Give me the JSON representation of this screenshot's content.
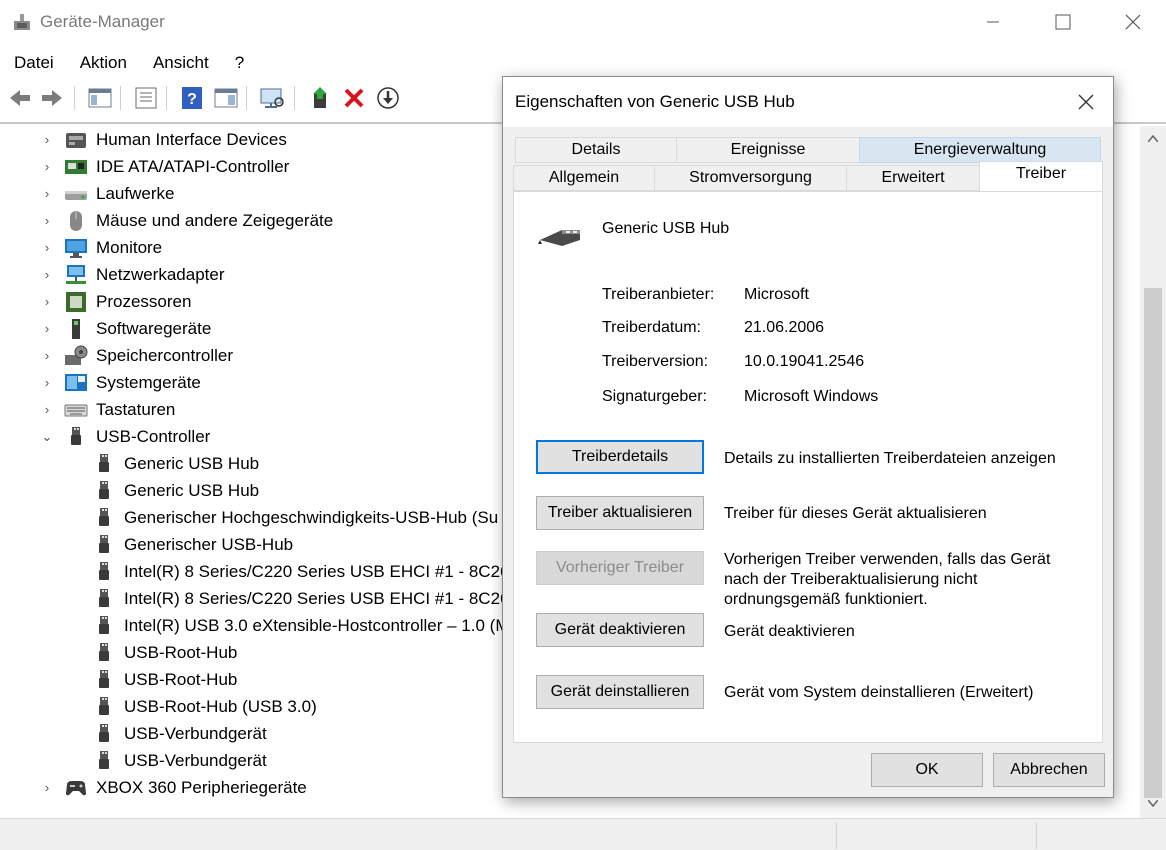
{
  "window": {
    "title": "Geräte-Manager"
  },
  "menu": [
    "Datei",
    "Aktion",
    "Ansicht",
    "?"
  ],
  "tree": {
    "rows": [
      {
        "label": "Human Interface Devices",
        "icon": "hid-icon",
        "expander": "›"
      },
      {
        "label": "IDE ATA/ATAPI-Controller",
        "icon": "ide-controller-icon",
        "expander": "›"
      },
      {
        "label": "Laufwerke",
        "icon": "drive-icon",
        "expander": "›"
      },
      {
        "label": "Mäuse und andere Zeigegeräte",
        "icon": "mouse-icon",
        "expander": "›"
      },
      {
        "label": "Monitore",
        "icon": "monitor-icon",
        "expander": "›"
      },
      {
        "label": "Netzwerkadapter",
        "icon": "network-adapter-icon",
        "expander": "›"
      },
      {
        "label": "Prozessoren",
        "icon": "processor-icon",
        "expander": "›"
      },
      {
        "label": "Softwaregeräte",
        "icon": "software-device-icon",
        "expander": "›"
      },
      {
        "label": "Speichercontroller",
        "icon": "storage-controller-icon",
        "expander": "›"
      },
      {
        "label": "Systemgeräte",
        "icon": "system-device-icon",
        "expander": "›"
      },
      {
        "label": "Tastaturen",
        "icon": "keyboard-icon",
        "expander": "›"
      },
      {
        "label": "USB-Controller",
        "icon": "usb-icon",
        "expander": "⌄"
      },
      {
        "label": "Generic USB Hub",
        "icon": "usb-icon",
        "child": true
      },
      {
        "label": "Generic USB Hub",
        "icon": "usb-icon",
        "child": true
      },
      {
        "label": "Generischer Hochgeschwindigkeits-USB-Hub (Su",
        "icon": "usb-icon",
        "child": true
      },
      {
        "label": "Generischer USB-Hub",
        "icon": "usb-icon",
        "child": true
      },
      {
        "label": "Intel(R) 8 Series/C220 Series USB EHCI #1 - 8C26",
        "icon": "usb-icon",
        "child": true
      },
      {
        "label": "Intel(R) 8 Series/C220 Series USB EHCI #1 - 8C26",
        "icon": "usb-icon",
        "child": true
      },
      {
        "label": "Intel(R) USB 3.0 eXtensible-Hostcontroller – 1.0 (M",
        "icon": "usb-icon",
        "child": true
      },
      {
        "label": "USB-Root-Hub",
        "icon": "usb-icon",
        "child": true
      },
      {
        "label": "USB-Root-Hub",
        "icon": "usb-icon",
        "child": true
      },
      {
        "label": "USB-Root-Hub (USB 3.0)",
        "icon": "usb-icon",
        "child": true
      },
      {
        "label": "USB-Verbundgerät",
        "icon": "usb-icon",
        "child": true
      },
      {
        "label": "USB-Verbundgerät",
        "icon": "usb-icon",
        "child": true
      },
      {
        "label": "XBOX 360 Peripheriegeräte",
        "icon": "gamepad-icon",
        "expander": "›"
      }
    ]
  },
  "dialog": {
    "title": "Eigenschaften von Generic USB Hub",
    "tabs_row1": [
      "Details",
      "Ereignisse",
      "Energieverwaltung"
    ],
    "tabs_row2": [
      "Allgemein",
      "Stromversorgung",
      "Erweitert",
      "Treiber"
    ],
    "active_tab": "Treiber",
    "hover_tab": "Energieverwaltung",
    "device_name": "Generic USB Hub",
    "info": {
      "provider_label": "Treiberanbieter:",
      "provider_value": "Microsoft",
      "date_label": "Treiberdatum:",
      "date_value": "21.06.2006",
      "version_label": "Treiberversion:",
      "version_value": "10.0.19041.2546",
      "signer_label": "Signaturgeber:",
      "signer_value": "Microsoft Windows"
    },
    "actions": {
      "details_btn": "Treiberdetails",
      "details_desc": "Details zu installierten Treiberdateien anzeigen",
      "update_btn": "Treiber aktualisieren",
      "update_desc": "Treiber für dieses Gerät aktualisieren",
      "rollback_btn": "Vorheriger Treiber",
      "rollback_desc": "Vorherigen Treiber verwenden, falls das Gerät nach der Treiberaktualisierung nicht ordnungsgemäß funktioniert.",
      "disable_btn": "Gerät deaktivieren",
      "disable_desc": "Gerät deaktivieren",
      "uninstall_btn": "Gerät deinstallieren",
      "uninstall_desc": "Gerät vom System deinstallieren (Erweitert)"
    },
    "ok_label": "OK",
    "cancel_label": "Abbrechen"
  },
  "colors": {
    "accent": "#0078d7",
    "tab_hover": "#d8e6f2",
    "delete_red": "#d8141c",
    "help_blue": "#2f5fbf"
  }
}
